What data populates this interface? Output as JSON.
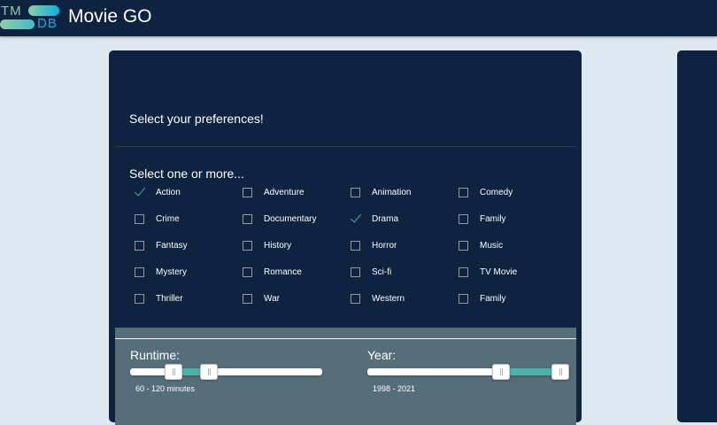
{
  "header": {
    "logo_top": "TM",
    "logo_bottom": "DB",
    "title": "Movie GO"
  },
  "preferences": {
    "title": "Select your preferences!",
    "genres_prompt": "Select one or more...",
    "genres": [
      {
        "label": "Action",
        "checked": true
      },
      {
        "label": "Adventure",
        "checked": false
      },
      {
        "label": "Animation",
        "checked": false
      },
      {
        "label": "Comedy",
        "checked": false
      },
      {
        "label": "Crime",
        "checked": false
      },
      {
        "label": "Documentary",
        "checked": false
      },
      {
        "label": "Drama",
        "checked": true
      },
      {
        "label": "Family",
        "checked": false
      },
      {
        "label": "Fantasy",
        "checked": false
      },
      {
        "label": "History",
        "checked": false
      },
      {
        "label": "Horror",
        "checked": false
      },
      {
        "label": "Music",
        "checked": false
      },
      {
        "label": "Mystery",
        "checked": false
      },
      {
        "label": "Romance",
        "checked": false
      },
      {
        "label": "Sci-fi",
        "checked": false
      },
      {
        "label": "TV Movie",
        "checked": false
      },
      {
        "label": "Thriller",
        "checked": false
      },
      {
        "label": "War",
        "checked": false
      },
      {
        "label": "Western",
        "checked": false
      },
      {
        "label": "Family",
        "checked": false
      }
    ]
  },
  "runtime": {
    "label": "Runtime:",
    "value_text": "60 - 120 minutes",
    "low_fraction": 0.2,
    "high_fraction": 0.4
  },
  "year": {
    "label": "Year:",
    "value_text": "1998 - 2021",
    "low_fraction": 0.68,
    "high_fraction": 1.0
  },
  "colors": {
    "background": "#dde8ef",
    "panel": "#0d233f",
    "slider_section": "#566d7a",
    "accent": "#49b2ad"
  }
}
